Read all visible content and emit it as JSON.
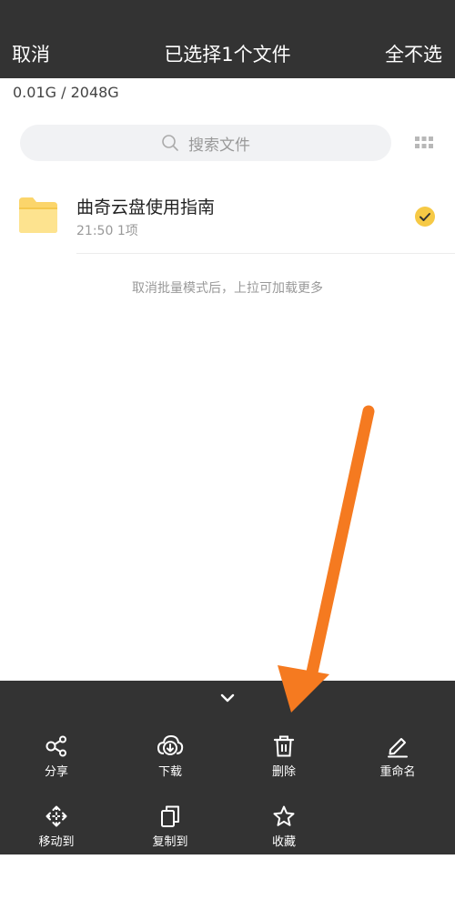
{
  "header": {
    "cancel_label": "取消",
    "title": "已选择1个文件",
    "deselect_all_label": "全不选"
  },
  "storage": {
    "usage": "0.01G / 2048G"
  },
  "search": {
    "placeholder": "搜索文件"
  },
  "files": [
    {
      "name": "曲奇云盘使用指南",
      "time": "21:50",
      "count": "1项",
      "selected": true
    }
  ],
  "hint": "取消批量模式后，上拉可加载更多",
  "actions": [
    {
      "label": "分享",
      "icon": "share-icon"
    },
    {
      "label": "下载",
      "icon": "download-icon"
    },
    {
      "label": "删除",
      "icon": "trash-icon"
    },
    {
      "label": "重命名",
      "icon": "pencil-icon"
    },
    {
      "label": "移动到",
      "icon": "move-icon"
    },
    {
      "label": "复制到",
      "icon": "copy-icon"
    },
    {
      "label": "收藏",
      "icon": "star-icon"
    }
  ],
  "colors": {
    "bar_bg": "#333333",
    "folder": "#fbd56b",
    "check": "#f6c945",
    "arrow": "#f57a20"
  }
}
